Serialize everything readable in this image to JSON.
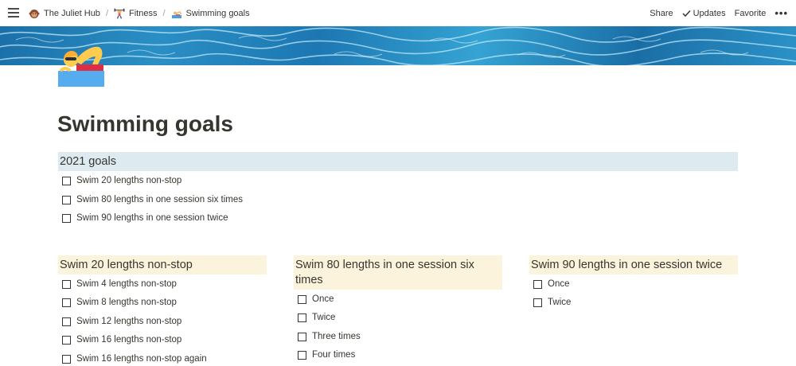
{
  "breadcrumb": {
    "items": [
      {
        "label": "The Juliet Hub",
        "icon": "monkey-face-icon"
      },
      {
        "label": "Fitness",
        "icon": "weight-lifter-icon"
      },
      {
        "label": "Swimming goals",
        "icon": "swimmer-icon"
      }
    ],
    "separator": "/"
  },
  "actions": {
    "share": "Share",
    "updates": "Updates",
    "favorite": "Favorite",
    "more": "•••"
  },
  "page": {
    "title": "Swimming goals",
    "icon": "swimmer-emoji-icon"
  },
  "goals_2021": {
    "heading": "2021 goals",
    "heading_color": "#ddebf1",
    "items": [
      "Swim 20 lengths non-stop",
      "Swim 80 lengths in one session six times",
      "Swim 90 lengths in one session twice"
    ]
  },
  "columns": [
    {
      "heading": "Swim 20 lengths non-stop",
      "items": [
        "Swim 4 lengths non-stop",
        "Swim 8 lengths non-stop",
        "Swim 12 lengths non-stop",
        "Swim 16 lengths non-stop",
        "Swim 16 lengths non-stop again"
      ]
    },
    {
      "heading_line1": "Swim 80 lengths in one session six",
      "heading_line2": "times",
      "items": [
        "Once",
        "Twice",
        "Three times",
        "Four times"
      ]
    },
    {
      "heading": "Swim 90 lengths in one session twice",
      "items": [
        "Once",
        "Twice"
      ]
    }
  ],
  "colors": {
    "callout_yellow": "#fbf3db",
    "callout_blue": "#ddebf1",
    "text": "#37352f"
  }
}
